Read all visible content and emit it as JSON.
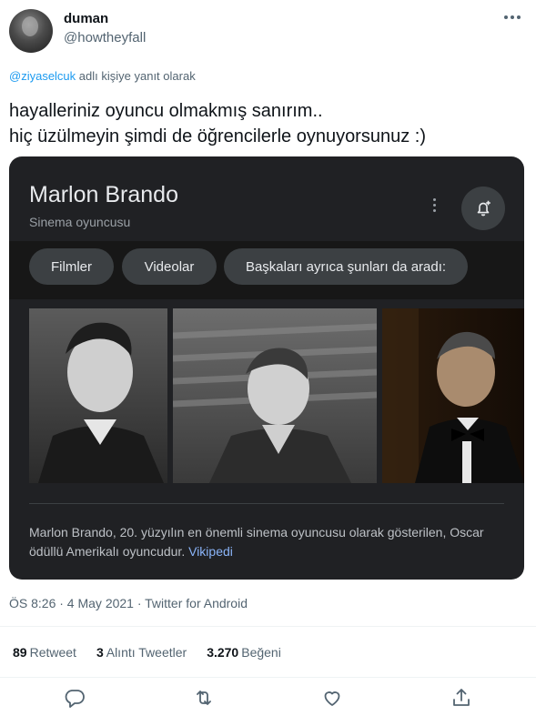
{
  "tweet": {
    "display_name": "duman",
    "handle": "@howtheyfall",
    "reply_mention": "@ziyaselcuk",
    "reply_suffix": "adlı kişiye yanıt olarak",
    "text_line1": "hayalleriniz oyuncu olmakmış sanırım..",
    "text_line2": "hiç üzülmeyin şimdi de öğrencilerle oynuyorsunuz :)",
    "timestamp": "ÖS 8:26 · 4 May 2021 · Twitter for Android"
  },
  "card": {
    "title": "Marlon Brando",
    "subtitle": "Sinema oyuncusu",
    "chips": [
      "Filmler",
      "Videolar",
      "Başkaları ayrıca şunları da aradı:"
    ],
    "description": "Marlon Brando, 20. yüzyılın en önemli sinema oyuncusu olarak gösterilen, Oscar ödüllü Amerikalı oyuncudur.",
    "wiki_link": "Vikipedi"
  },
  "stats": {
    "retweets_count": "89",
    "retweets_label": "Retweet",
    "quotes_count": "3",
    "quotes_label": "Alıntı Tweetler",
    "likes_count": "3.270",
    "likes_label": "Beğeni"
  },
  "icons": {
    "reply": "reply-icon",
    "retweet": "retweet-icon",
    "like": "heart-icon",
    "share": "share-icon",
    "more": "more-icon",
    "bell": "bell-add-icon"
  },
  "colors": {
    "link": "#1d9bf0",
    "muted": "#536471",
    "card_bg": "#202124",
    "wiki": "#8ab4f8"
  }
}
